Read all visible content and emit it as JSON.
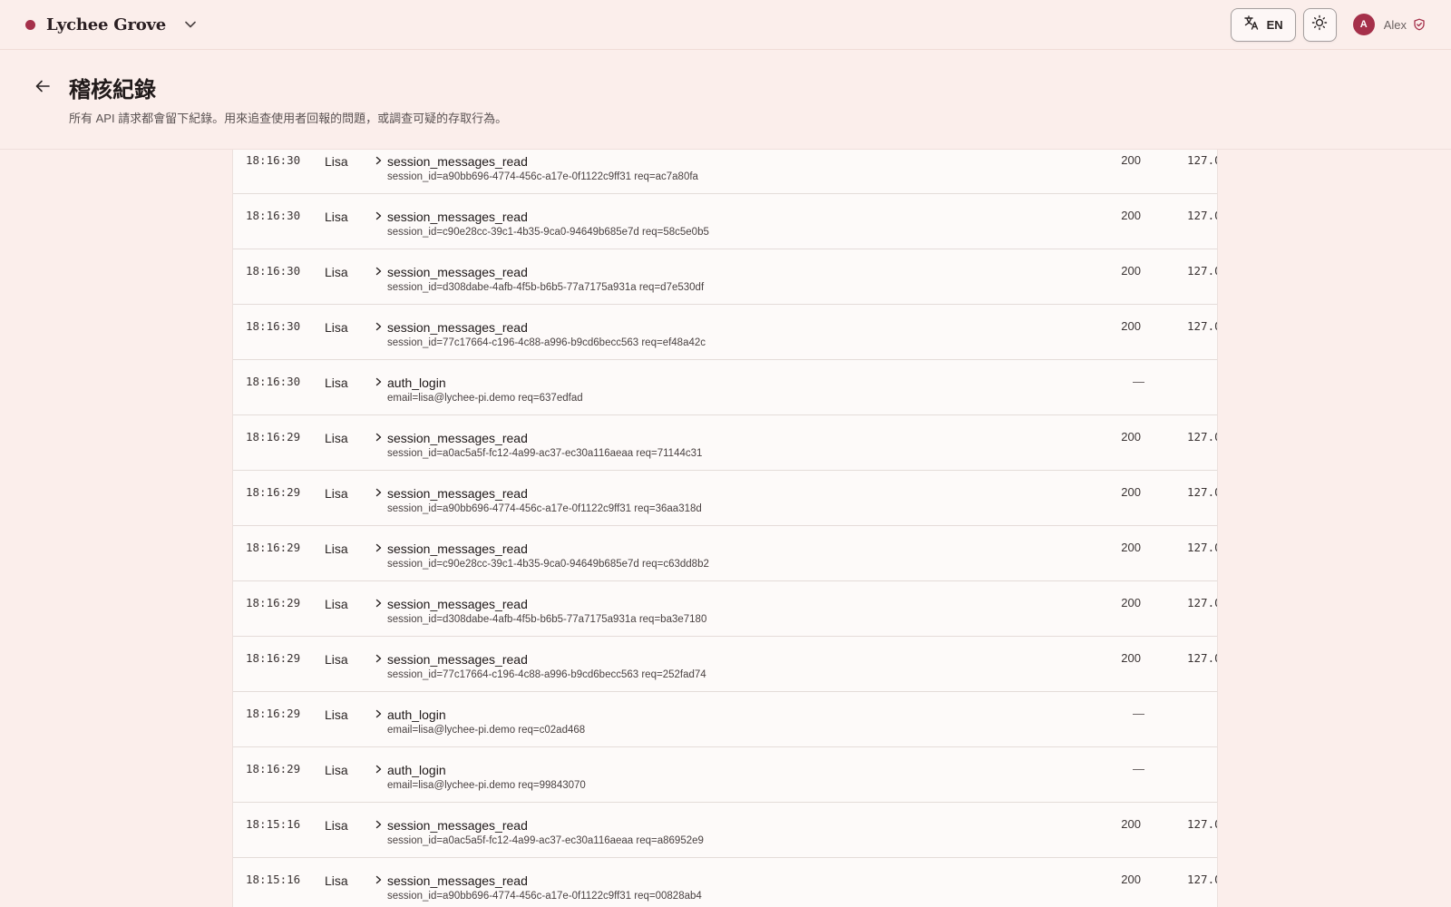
{
  "app": {
    "name": "Lychee Grove",
    "accent": "#a5304a"
  },
  "topbar": {
    "language_label": "EN",
    "user": {
      "initial": "A",
      "name": "Alex"
    }
  },
  "page": {
    "title": "稽核紀錄",
    "subtitle": "所有 API 請求都會留下紀錄。用來追查使用者回報的問題，或調查可疑的存取行為。"
  },
  "log": {
    "rows": [
      {
        "time": "18:16:30",
        "actor": "Lisa",
        "action": "session_messages_read",
        "detail": "session_id=a90bb696-4774-456c-a17e-0f1122c9ff31 req=ac7a80fa",
        "status": "200",
        "ip": "127.0"
      },
      {
        "time": "18:16:30",
        "actor": "Lisa",
        "action": "session_messages_read",
        "detail": "session_id=c90e28cc-39c1-4b35-9ca0-94649b685e7d req=58c5e0b5",
        "status": "200",
        "ip": "127.0"
      },
      {
        "time": "18:16:30",
        "actor": "Lisa",
        "action": "session_messages_read",
        "detail": "session_id=d308dabe-4afb-4f5b-b6b5-77a7175a931a req=d7e530df",
        "status": "200",
        "ip": "127.0"
      },
      {
        "time": "18:16:30",
        "actor": "Lisa",
        "action": "session_messages_read",
        "detail": "session_id=77c17664-c196-4c88-a996-b9cd6becc563 req=ef48a42c",
        "status": "200",
        "ip": "127.0"
      },
      {
        "time": "18:16:30",
        "actor": "Lisa",
        "action": "auth_login",
        "detail": "email=lisa@lychee-pi.demo req=637edfad",
        "status": "—",
        "ip": ""
      },
      {
        "time": "18:16:29",
        "actor": "Lisa",
        "action": "session_messages_read",
        "detail": "session_id=a0ac5a5f-fc12-4a99-ac37-ec30a116aeaa req=71144c31",
        "status": "200",
        "ip": "127.0"
      },
      {
        "time": "18:16:29",
        "actor": "Lisa",
        "action": "session_messages_read",
        "detail": "session_id=a90bb696-4774-456c-a17e-0f1122c9ff31 req=36aa318d",
        "status": "200",
        "ip": "127.0"
      },
      {
        "time": "18:16:29",
        "actor": "Lisa",
        "action": "session_messages_read",
        "detail": "session_id=c90e28cc-39c1-4b35-9ca0-94649b685e7d req=c63dd8b2",
        "status": "200",
        "ip": "127.0"
      },
      {
        "time": "18:16:29",
        "actor": "Lisa",
        "action": "session_messages_read",
        "detail": "session_id=d308dabe-4afb-4f5b-b6b5-77a7175a931a req=ba3e7180",
        "status": "200",
        "ip": "127.0"
      },
      {
        "time": "18:16:29",
        "actor": "Lisa",
        "action": "session_messages_read",
        "detail": "session_id=77c17664-c196-4c88-a996-b9cd6becc563 req=252fad74",
        "status": "200",
        "ip": "127.0"
      },
      {
        "time": "18:16:29",
        "actor": "Lisa",
        "action": "auth_login",
        "detail": "email=lisa@lychee-pi.demo req=c02ad468",
        "status": "—",
        "ip": ""
      },
      {
        "time": "18:16:29",
        "actor": "Lisa",
        "action": "auth_login",
        "detail": "email=lisa@lychee-pi.demo req=99843070",
        "status": "—",
        "ip": ""
      },
      {
        "time": "18:15:16",
        "actor": "Lisa",
        "action": "session_messages_read",
        "detail": "session_id=a0ac5a5f-fc12-4a99-ac37-ec30a116aeaa req=a86952e9",
        "status": "200",
        "ip": "127.0"
      },
      {
        "time": "18:15:16",
        "actor": "Lisa",
        "action": "session_messages_read",
        "detail": "session_id=a90bb696-4774-456c-a17e-0f1122c9ff31 req=00828ab4",
        "status": "200",
        "ip": "127.0"
      }
    ]
  }
}
